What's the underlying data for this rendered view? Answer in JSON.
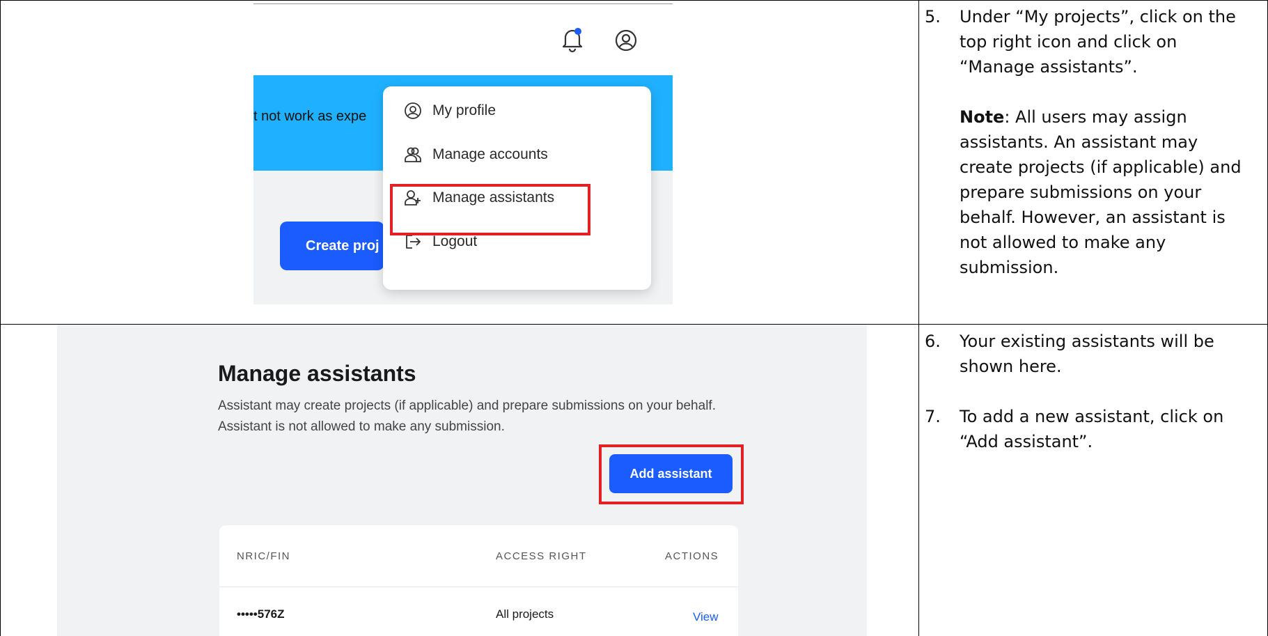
{
  "step5": {
    "number": "5.",
    "text": "Under “My projects”, click on the top right icon and click on “Manage assistants”.",
    "note_label": "Note",
    "note_text": ": All users may assign assistants. An assistant may create projects (if applicable) and prepare submissions on your behalf. However, an assistant is not allowed to make any submission."
  },
  "step6": {
    "number": "6.",
    "text": "Your existing assistants will be shown here."
  },
  "step7": {
    "number": "7.",
    "text": "To add a new assistant, click on “Add assistant”."
  },
  "screenshot1": {
    "banner_text": "t not work as expe",
    "create_button": "Create proj",
    "menu": [
      {
        "label": "My profile",
        "icon": "user-circle-icon"
      },
      {
        "label": "Manage accounts",
        "icon": "users-icon"
      },
      {
        "label": "Manage assistants",
        "icon": "user-plus-icon"
      },
      {
        "label": "Logout",
        "icon": "logout-icon"
      }
    ],
    "colors": {
      "banner": "#1fb1ff",
      "primary": "#1a5cff",
      "highlight": "#e32024",
      "notification_dot": "#1a5cff"
    }
  },
  "screenshot2": {
    "title": "Manage assistants",
    "description": "Assistant may create projects (if applicable) and prepare submissions on your behalf. Assistant is not allowed to make any submission.",
    "add_button": "Add assistant",
    "table": {
      "headers": [
        "NRIC/FIN",
        "ACCESS RIGHT",
        "ACTIONS"
      ],
      "rows": [
        {
          "nric": "•••••576Z",
          "access": "All projects",
          "action": "View"
        }
      ]
    }
  }
}
